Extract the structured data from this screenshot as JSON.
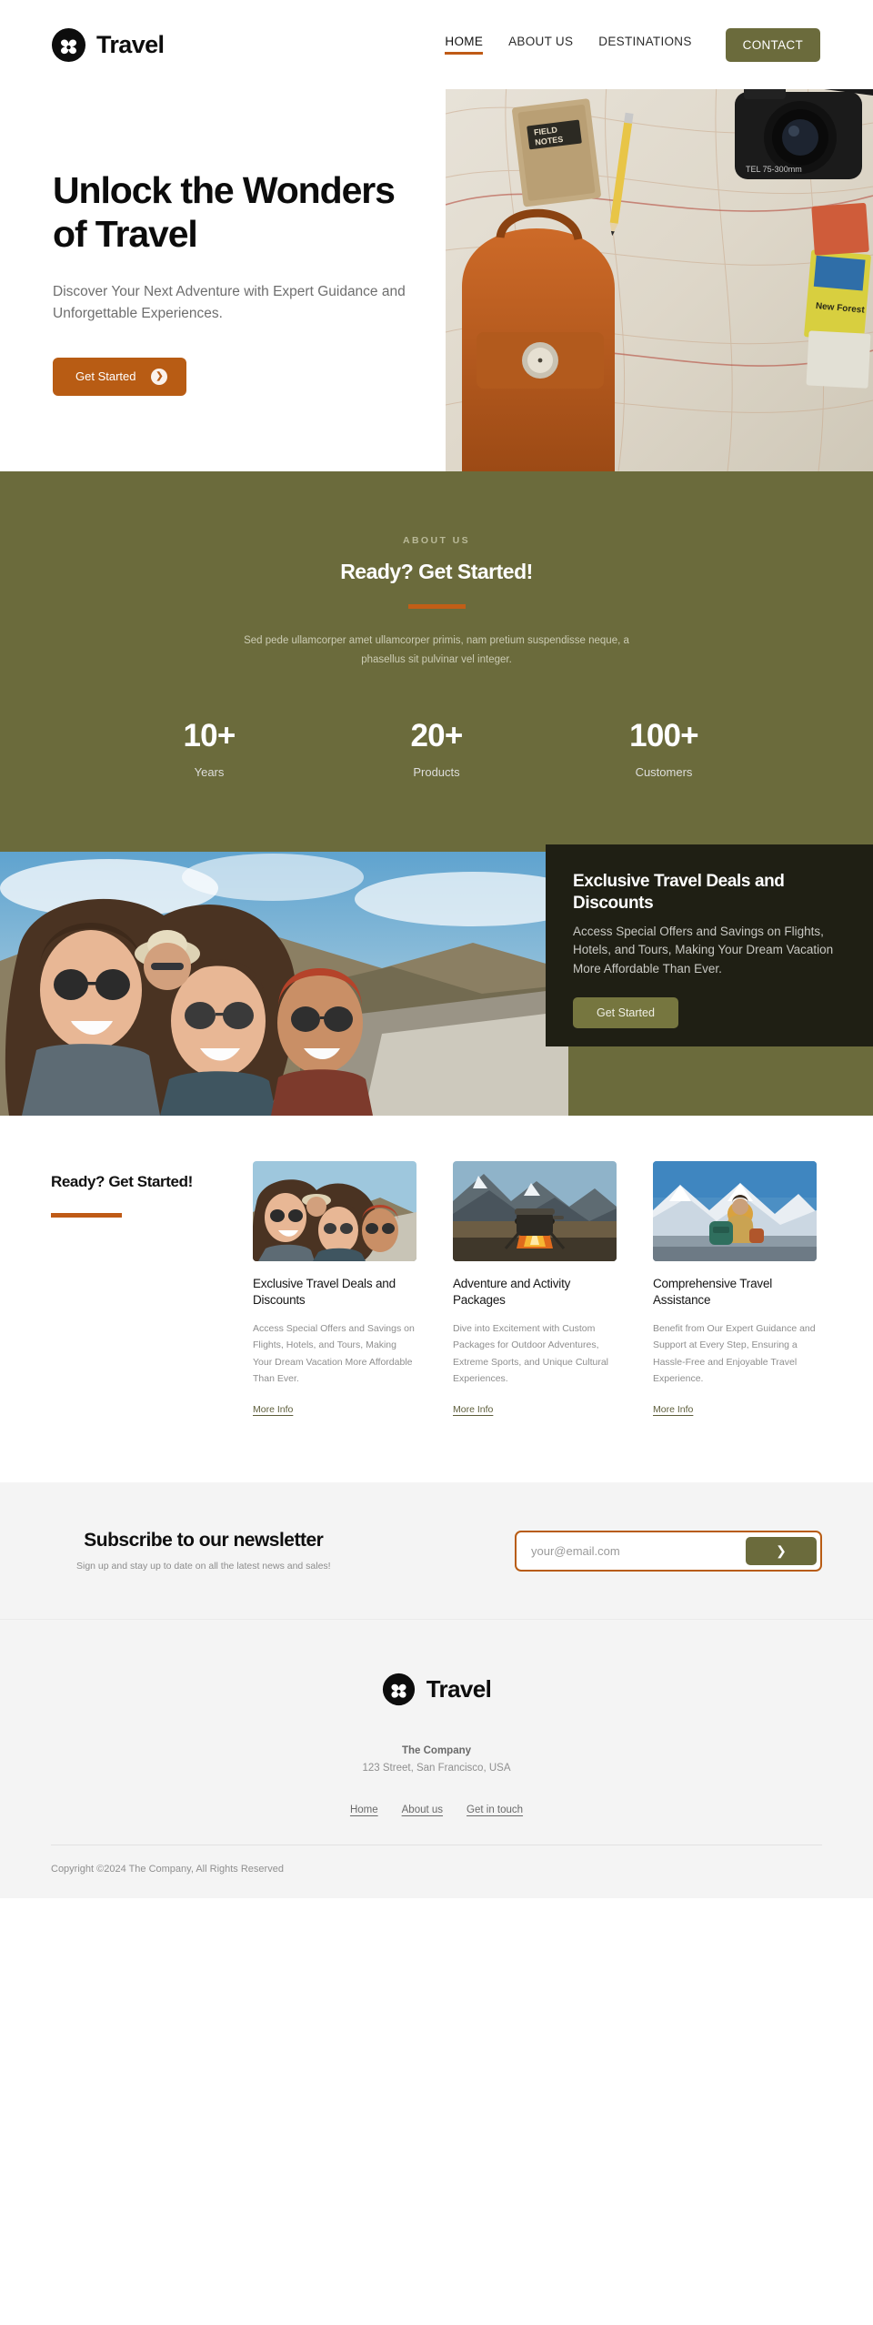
{
  "brand": {
    "name": "Travel",
    "logo_icon": "clover-circle-logo"
  },
  "nav": {
    "items": [
      {
        "label": "HOME",
        "active": true
      },
      {
        "label": "ABOUT US",
        "active": false
      },
      {
        "label": "DESTINATIONS",
        "active": false
      }
    ],
    "contact_label": "CONTACT"
  },
  "hero": {
    "title_line1": "Unlock the Wonders",
    "title_line2": "of Travel",
    "subtitle": "Discover Your Next Adventure with Expert Guidance and Unforgettable Experiences.",
    "cta_label": "Get Started",
    "cta_icon": "chevron-right-circle-icon",
    "image_alt": "flat-lay of map, camera, field notes notebook, pencil and orange backpack"
  },
  "about": {
    "eyebrow": "ABOUT US",
    "title": "Ready? Get Started!",
    "body": "Sed pede ullamcorper amet ullamcorper primis, nam pretium suspendisse neque, a phasellus sit pulvinar vel integer.",
    "accent_color": "#c25e17",
    "background_color": "#6b6b3c",
    "stats": [
      {
        "value": "10+",
        "label": "Years"
      },
      {
        "value": "20+",
        "label": "Products"
      },
      {
        "value": "100+",
        "label": "Customers"
      }
    ]
  },
  "showcase": {
    "image_alt": "three laughing friends with sunglasses on a coastal road trip",
    "card": {
      "title": "Exclusive Travel Deals and Discounts",
      "text": "Access Special Offers and Savings on Flights, Hotels, and Tours, Making Your Dream Vacation More Affordable Than Ever.",
      "cta_label": "Get Started",
      "background_color": "#1f1f14"
    }
  },
  "services": {
    "heading": "Ready? Get Started!",
    "accent_color": "#bf5a16",
    "cards": [
      {
        "title": "Exclusive Travel Deals and Discounts",
        "text": "Access Special Offers and Savings on Flights, Hotels, and Tours, Making Your Dream Vacation More Affordable Than Ever.",
        "link_label": "More Info",
        "image_alt": "friends smiling together on a road trip"
      },
      {
        "title": "Adventure and Activity Packages",
        "text": "Dive into Excitement with Custom Packages for Outdoor Adventures, Extreme Sports, and Unique Cultural Experiences.",
        "link_label": "More Info",
        "image_alt": "campfire with kettle in front of mountains"
      },
      {
        "title": "Comprehensive Travel Assistance",
        "text": "Benefit from Our Expert Guidance and Support at Every Step, Ensuring a Hassle-Free and Enjoyable Travel Experience.",
        "link_label": "More Info",
        "image_alt": "hiker sitting with backpack on snowy mountain overlook"
      }
    ]
  },
  "newsletter": {
    "title": "Subscribe to our newsletter",
    "subtitle": "Sign up and stay up to date on all the latest news and sales!",
    "placeholder": "your@email.com",
    "input_value": "",
    "submit_icon": "chevron-right-icon",
    "border_color": "#b85c14"
  },
  "footer": {
    "brand_name": "Travel",
    "company": "The Company",
    "address": "123 Street, San Francisco, USA",
    "links": [
      {
        "label": "Home"
      },
      {
        "label": "About us"
      },
      {
        "label": "Get in touch"
      }
    ],
    "copyright": "Copyright ©2024 The Company, All Rights Reserved"
  }
}
